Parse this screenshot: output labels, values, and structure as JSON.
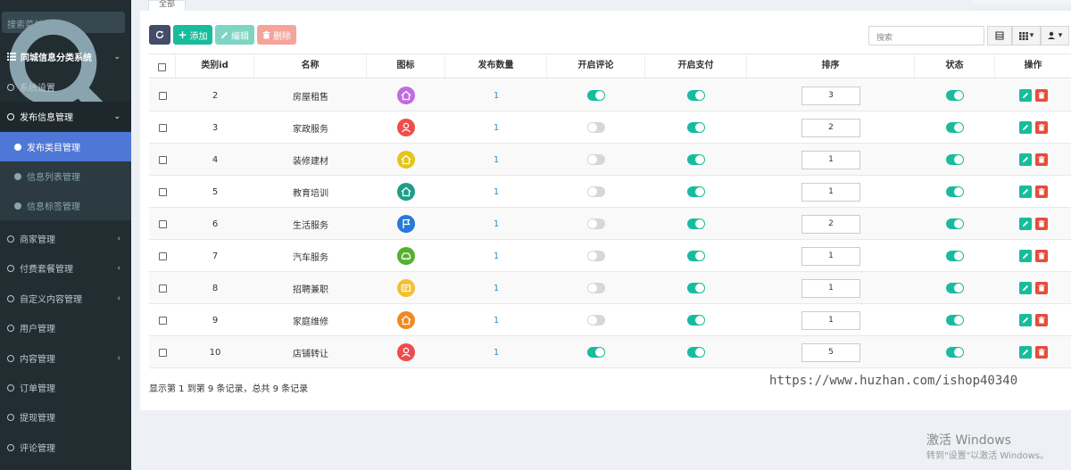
{
  "sidebar": {
    "search_placeholder": "搜索菜单",
    "items": [
      {
        "label": "同城信息分类系统"
      },
      {
        "label": "系统设置"
      },
      {
        "label": "发布信息管理"
      },
      {
        "label": "发布类目管理"
      },
      {
        "label": "信息列表管理"
      },
      {
        "label": "信息标签管理"
      },
      {
        "label": "商家管理"
      },
      {
        "label": "付费套餐管理"
      },
      {
        "label": "自定义内容管理"
      },
      {
        "label": "用户管理"
      },
      {
        "label": "内容管理"
      },
      {
        "label": "订单管理"
      },
      {
        "label": "提现管理"
      },
      {
        "label": "评论管理"
      }
    ]
  },
  "tab": {
    "label": "全部"
  },
  "toolbar": {
    "add_label": "添加",
    "edit_label": "编辑",
    "delete_label": "删除",
    "search_placeholder": "搜索"
  },
  "table": {
    "headers": [
      "类别id",
      "名称",
      "图标",
      "发布数量",
      "开启评论",
      "开启支付",
      "排序",
      "状态",
      "操作"
    ],
    "rows": [
      {
        "id": "2",
        "name": "房屋租售",
        "icon_color": "#c06be0",
        "icon": "house-icon",
        "count": "1",
        "comment": true,
        "pay": true,
        "sort": "3",
        "status": true
      },
      {
        "id": "3",
        "name": "家政服务",
        "icon_color": "#ec4d4d",
        "icon": "person-icon",
        "count": "1",
        "comment": false,
        "pay": true,
        "sort": "2",
        "status": true
      },
      {
        "id": "4",
        "name": "装修建材",
        "icon_color": "#e3c51c",
        "icon": "house-icon",
        "count": "1",
        "comment": false,
        "pay": true,
        "sort": "1",
        "status": true
      },
      {
        "id": "5",
        "name": "教育培训",
        "icon_color": "#1f9d8a",
        "icon": "house-icon",
        "count": "1",
        "comment": false,
        "pay": true,
        "sort": "1",
        "status": true
      },
      {
        "id": "6",
        "name": "生活服务",
        "icon_color": "#2779d8",
        "icon": "flag-icon",
        "count": "1",
        "comment": false,
        "pay": true,
        "sort": "2",
        "status": true
      },
      {
        "id": "7",
        "name": "汽车服务",
        "icon_color": "#54b02e",
        "icon": "car-icon",
        "count": "1",
        "comment": false,
        "pay": true,
        "sort": "1",
        "status": true
      },
      {
        "id": "8",
        "name": "招聘兼职",
        "icon_color": "#f2c030",
        "icon": "badge-icon",
        "count": "1",
        "comment": false,
        "pay": true,
        "sort": "1",
        "status": true
      },
      {
        "id": "9",
        "name": "家庭维修",
        "icon_color": "#f08a24",
        "icon": "house-icon",
        "count": "1",
        "comment": false,
        "pay": true,
        "sort": "1",
        "status": true
      },
      {
        "id": "10",
        "name": "店铺转让",
        "icon_color": "#ec4d4d",
        "icon": "person-icon",
        "count": "1",
        "comment": true,
        "pay": true,
        "sort": "5",
        "status": true
      }
    ]
  },
  "footer": {
    "info": "显示第 1 到第 9 条记录，总共 9 条记录"
  },
  "overlay": {
    "url": "https://www.huzhan.com/ishop40340",
    "win_title": "激活 Windows",
    "win_sub": "转到\"设置\"以激活 Windows。"
  },
  "colors": {
    "sidebar_bg": "#222d32",
    "active_item": "#4f77d6",
    "success": "#18bc9c",
    "danger": "#e74c3c"
  }
}
